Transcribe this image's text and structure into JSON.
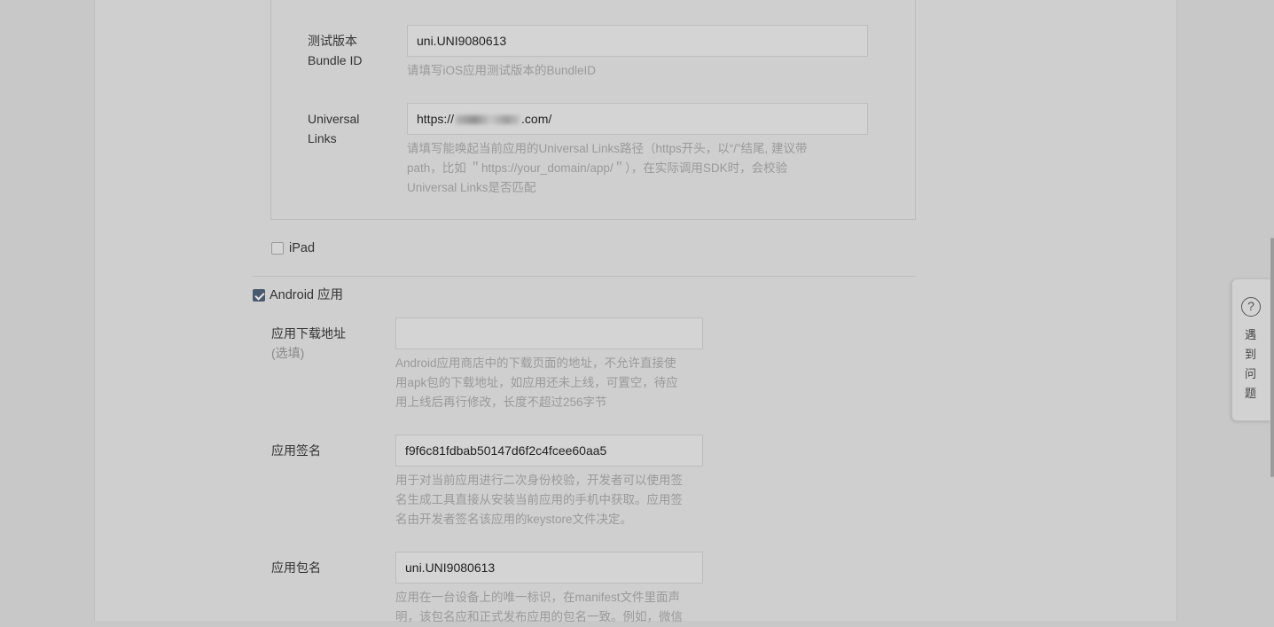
{
  "ios": {
    "test_bundle": {
      "label_line1": "测试版本",
      "label_line2": "Bundle ID",
      "value": "uni.UNI9080613",
      "hint": "请填写iOS应用测试版本的BundleID"
    },
    "universal_links": {
      "label_line1": "Universal",
      "label_line2": "Links",
      "value_prefix": "https://",
      "value_suffix": ".com/",
      "hint_line1": "请填写能唤起当前应用的Universal Links路径（https开头，以“/”结尾, 建议带",
      "hint_line2": "path，比如 ＂https://your_domain/app/＂），在实际调用SDK时，会校验",
      "hint_line3": "Universal Links是否匹配"
    },
    "ipad_label": "iPad"
  },
  "android": {
    "checkbox_label": "Android 应用",
    "download_url": {
      "label": "应用下载地址",
      "label_sub": "(选填)",
      "value": "",
      "hint_line1": "Android应用商店中的下载页面的地址，不允许直接使",
      "hint_line2": "用apk包的下载地址，如应用还未上线，可置空，待应",
      "hint_line3": "用上线后再行修改，长度不超过256字节"
    },
    "signature": {
      "label": "应用签名",
      "value": "f9f6c81fdbab50147d6f2c4fcee60aa5",
      "hint_line1": "用于对当前应用进行二次身份校验，开发者可以使用签",
      "hint_line2": "名生成工具直接从安装当前应用的手机中获取。应用签",
      "hint_line3": "名由开发者签名该应用的keystore文件决定。"
    },
    "package": {
      "label": "应用包名",
      "value": "uni.UNI9080613",
      "hint_line1": "应用在一台设备上的唯一标识，在manifest文件里面声",
      "hint_line2": "明，该包名应和正式发布应用的包名一致。例如，微信"
    }
  },
  "help": {
    "icon": "question-circle-icon",
    "text": "遇到问题"
  }
}
